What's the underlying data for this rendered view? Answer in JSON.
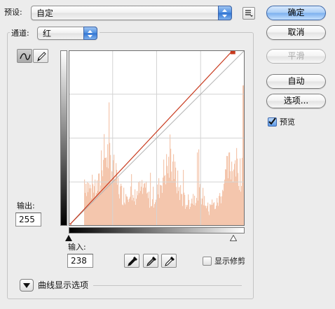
{
  "preset": {
    "label": "预设:",
    "value": "自定"
  },
  "channel": {
    "label": "通道:",
    "value": "红"
  },
  "buttons": {
    "ok": "确定",
    "cancel": "取消",
    "smooth": "平滑",
    "auto": "自动",
    "options": "选项..."
  },
  "preview": {
    "label": "预览",
    "checked": true
  },
  "output": {
    "label": "输出:",
    "value": "255"
  },
  "input": {
    "label": "输入:",
    "value": "238"
  },
  "show_clipping": {
    "label": "显示修剪",
    "checked": false
  },
  "curve_display_options": {
    "label": "曲线显示选项"
  },
  "curve": {
    "points": [
      [
        0,
        0
      ],
      [
        238,
        255
      ],
      [
        255,
        255
      ]
    ],
    "color": "#c83a1e",
    "histogram_color": "#f4c6ad"
  }
}
